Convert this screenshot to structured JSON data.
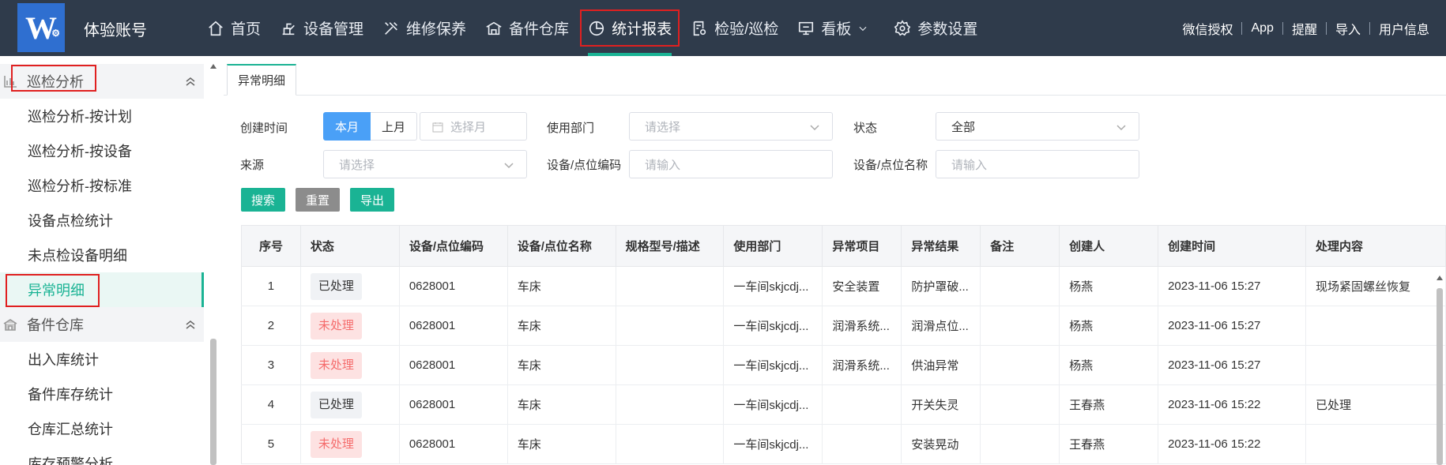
{
  "topbar": {
    "logo_text": "W",
    "account": "体验账号",
    "nav": [
      {
        "label": "首页",
        "icon": "home-icon"
      },
      {
        "label": "设备管理",
        "icon": "device-icon"
      },
      {
        "label": "维修保养",
        "icon": "tools-icon"
      },
      {
        "label": "备件仓库",
        "icon": "warehouse-icon"
      },
      {
        "label": "统计报表",
        "icon": "pie-chart-icon"
      },
      {
        "label": "检验/巡检",
        "icon": "inspect-icon"
      },
      {
        "label": "看板",
        "icon": "dashboard-icon"
      },
      {
        "label": "参数设置",
        "icon": "gear-icon"
      }
    ],
    "right_links": [
      "微信授权",
      "App",
      "提醒",
      "导入",
      "用户信息"
    ]
  },
  "sidebar": {
    "group1": {
      "label": "巡检分析",
      "icon": "bar-chart-icon"
    },
    "group1_items": [
      "巡检分析-按计划",
      "巡检分析-按设备",
      "巡检分析-按标准",
      "设备点检统计",
      "未点检设备明细",
      "异常明细"
    ],
    "group2": {
      "label": "备件仓库",
      "icon": "warehouse-icon"
    },
    "group2_items": [
      "出入库统计",
      "备件库存统计",
      "仓库汇总统计",
      "库存预警分析"
    ]
  },
  "tab": {
    "label": "异常明细"
  },
  "filters": {
    "create_time_label": "创建时间",
    "this_month": "本月",
    "last_month": "上月",
    "month_placeholder": "选择月",
    "dept_label": "使用部门",
    "dept_placeholder": "请选择",
    "status_label": "状态",
    "status_value": "全部",
    "source_label": "来源",
    "source_placeholder": "请选择",
    "code_label": "设备/点位编码",
    "code_placeholder": "请输入",
    "name_label": "设备/点位名称",
    "name_placeholder": "请输入"
  },
  "buttons": {
    "search": "搜索",
    "reset": "重置",
    "export": "导出"
  },
  "colors": {
    "accent": "#1ab394",
    "nav_bg": "#2f3b4b",
    "primary_blue": "#4aa0f7",
    "danger": "#e02020"
  },
  "table": {
    "headers": [
      "序号",
      "状态",
      "设备/点位编码",
      "设备/点位名称",
      "规格型号/描述",
      "使用部门",
      "异常项目",
      "异常结果",
      "备注",
      "创建人",
      "创建时间",
      "处理内容"
    ],
    "rows": [
      {
        "no": "1",
        "status": "已处理",
        "done": true,
        "code": "0628001",
        "name": "车床",
        "spec": "",
        "dept": "一车间skjcdj...",
        "item": "安全装置",
        "result": "防护罩破...",
        "note": "",
        "creator": "杨燕",
        "time": "2023-11-06 15:27",
        "handle": "现场紧固螺丝恢复"
      },
      {
        "no": "2",
        "status": "未处理",
        "done": false,
        "code": "0628001",
        "name": "车床",
        "spec": "",
        "dept": "一车间skjcdj...",
        "item": "润滑系统...",
        "result": "润滑点位...",
        "note": "",
        "creator": "杨燕",
        "time": "2023-11-06 15:27",
        "handle": ""
      },
      {
        "no": "3",
        "status": "未处理",
        "done": false,
        "code": "0628001",
        "name": "车床",
        "spec": "",
        "dept": "一车间skjcdj...",
        "item": "润滑系统...",
        "result": "供油异常",
        "note": "",
        "creator": "杨燕",
        "time": "2023-11-06 15:27",
        "handle": ""
      },
      {
        "no": "4",
        "status": "已处理",
        "done": true,
        "code": "0628001",
        "name": "车床",
        "spec": "",
        "dept": "一车间skjcdj...",
        "item": "",
        "result": "开关失灵",
        "note": "",
        "creator": "王春燕",
        "time": "2023-11-06 15:22",
        "handle": "已处理"
      },
      {
        "no": "5",
        "status": "未处理",
        "done": false,
        "code": "0628001",
        "name": "车床",
        "spec": "",
        "dept": "一车间skjcdj...",
        "item": "",
        "result": "安装晃动",
        "note": "",
        "creator": "王春燕",
        "time": "2023-11-06 15:22",
        "handle": ""
      }
    ]
  }
}
